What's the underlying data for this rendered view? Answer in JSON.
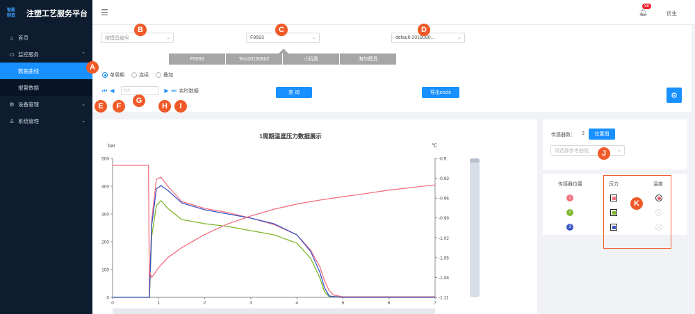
{
  "app": {
    "logo_text_1": "智能",
    "logo_text_2": "制造",
    "title": "注塑工艺服务平台"
  },
  "sidebar": {
    "items": [
      {
        "label": "首页",
        "icon": "home-icon"
      },
      {
        "label": "监控服务",
        "icon": "monitor-icon"
      },
      {
        "label": "设备管理",
        "icon": "gear-icon"
      },
      {
        "label": "系统管理",
        "icon": "user-icon"
      }
    ],
    "sub_items": [
      {
        "label": "数据曲线",
        "active": true
      },
      {
        "label": "报警数据",
        "active": false
      }
    ]
  },
  "header": {
    "notification_count": "58",
    "user": "优生"
  },
  "filters": {
    "mold_placeholder": "按模具编号",
    "mold_code": "F9593",
    "default_value": "default-2019080..."
  },
  "segments": [
    "F9593",
    "Test20190802",
    "小玩意",
    "海尔模具"
  ],
  "modes": [
    {
      "label": "单周期",
      "selected": true
    },
    {
      "label": "连续",
      "selected": false
    },
    {
      "label": "叠加",
      "selected": false
    }
  ],
  "playback": {
    "cycle_placeholder": "0.0",
    "realtime_label": "实时数据"
  },
  "buttons": {
    "query": "查 询",
    "export": "导出excle"
  },
  "sensor_panel": {
    "count_label": "传感器数：",
    "count": "3",
    "position_button": "位置图",
    "ref_curve_placeholder": "请选择参考曲线"
  },
  "sensor_table": {
    "headers": [
      "传感器位置",
      "压力",
      "温度"
    ],
    "rows": [
      {
        "id": "1",
        "color": "#f3707e",
        "pressure_color": "#f3707e",
        "temp_on": true
      },
      {
        "id": "2",
        "color": "#7cb72a",
        "pressure_color": "#7cb72a",
        "temp_on": false
      },
      {
        "id": "3",
        "color": "#3a55c8",
        "pressure_color": "#3a55c8",
        "temp_on": false
      }
    ]
  },
  "markers": [
    "A",
    "B",
    "C",
    "D",
    "E",
    "F",
    "G",
    "H",
    "I",
    "J",
    "K"
  ],
  "chart_data": {
    "type": "line",
    "title": "1周期温度压力数据展示",
    "ylabel": "bar",
    "y2label": "℃",
    "xlim": [
      0,
      7
    ],
    "ylim": [
      0,
      500
    ],
    "y2lim": [
      -1.11,
      -0.9
    ],
    "x_ticks": [
      0,
      1,
      2,
      3,
      4,
      5,
      6,
      7
    ],
    "y_ticks": [
      0,
      100,
      200,
      300,
      400,
      500
    ],
    "y2_ticks": [
      -1.11,
      -1.08,
      -1.05,
      -1.02,
      -0.99,
      -0.96,
      -0.93,
      -0.9
    ],
    "series": [
      {
        "color": "#f3707e",
        "axis": "left",
        "x": [
          0,
          0.78,
          0.8,
          0.85,
          0.95,
          1.05,
          1.2,
          1.5,
          2,
          2.5,
          3,
          3.5,
          4,
          4.3,
          4.5,
          4.6,
          4.7,
          4.8,
          5,
          7
        ],
        "y": [
          475,
          475,
          0,
          280,
          425,
          432,
          400,
          345,
          320,
          305,
          285,
          262,
          225,
          170,
          110,
          60,
          25,
          8,
          2,
          2
        ]
      },
      {
        "color": "#7cb72a",
        "axis": "left",
        "x": [
          0,
          0.78,
          0.8,
          0.85,
          0.95,
          1.05,
          1.2,
          1.5,
          2,
          2.5,
          3,
          3.5,
          4,
          4.3,
          4.5,
          4.6,
          4.7,
          5,
          7
        ],
        "y": [
          0,
          0,
          0,
          220,
          330,
          348,
          320,
          280,
          265,
          255,
          240,
          225,
          195,
          140,
          70,
          20,
          3,
          0,
          0
        ]
      },
      {
        "color": "#3a55c8",
        "axis": "left",
        "x": [
          0,
          0.78,
          0.8,
          0.85,
          0.95,
          1.05,
          1.2,
          1.5,
          2,
          2.5,
          3,
          3.5,
          4,
          4.3,
          4.5,
          4.6,
          4.7,
          5,
          7
        ],
        "y": [
          0,
          0,
          0,
          260,
          390,
          402,
          385,
          340,
          315,
          300,
          285,
          265,
          225,
          165,
          90,
          35,
          5,
          0,
          0
        ]
      },
      {
        "color": "#f3707e",
        "axis": "right",
        "x": [
          0.8,
          0.85,
          0.9,
          1,
          1.2,
          1.5,
          2,
          2.5,
          3,
          3.5,
          4,
          4.5,
          5,
          5.5,
          6,
          6.5,
          7
        ],
        "y": [
          -1.07,
          -1.08,
          -1.075,
          -1.065,
          -1.05,
          -1.035,
          -1.015,
          -0.999,
          -0.987,
          -0.977,
          -0.969,
          -0.963,
          -0.958,
          -0.953,
          -0.948,
          -0.944,
          -0.94
        ]
      }
    ]
  }
}
